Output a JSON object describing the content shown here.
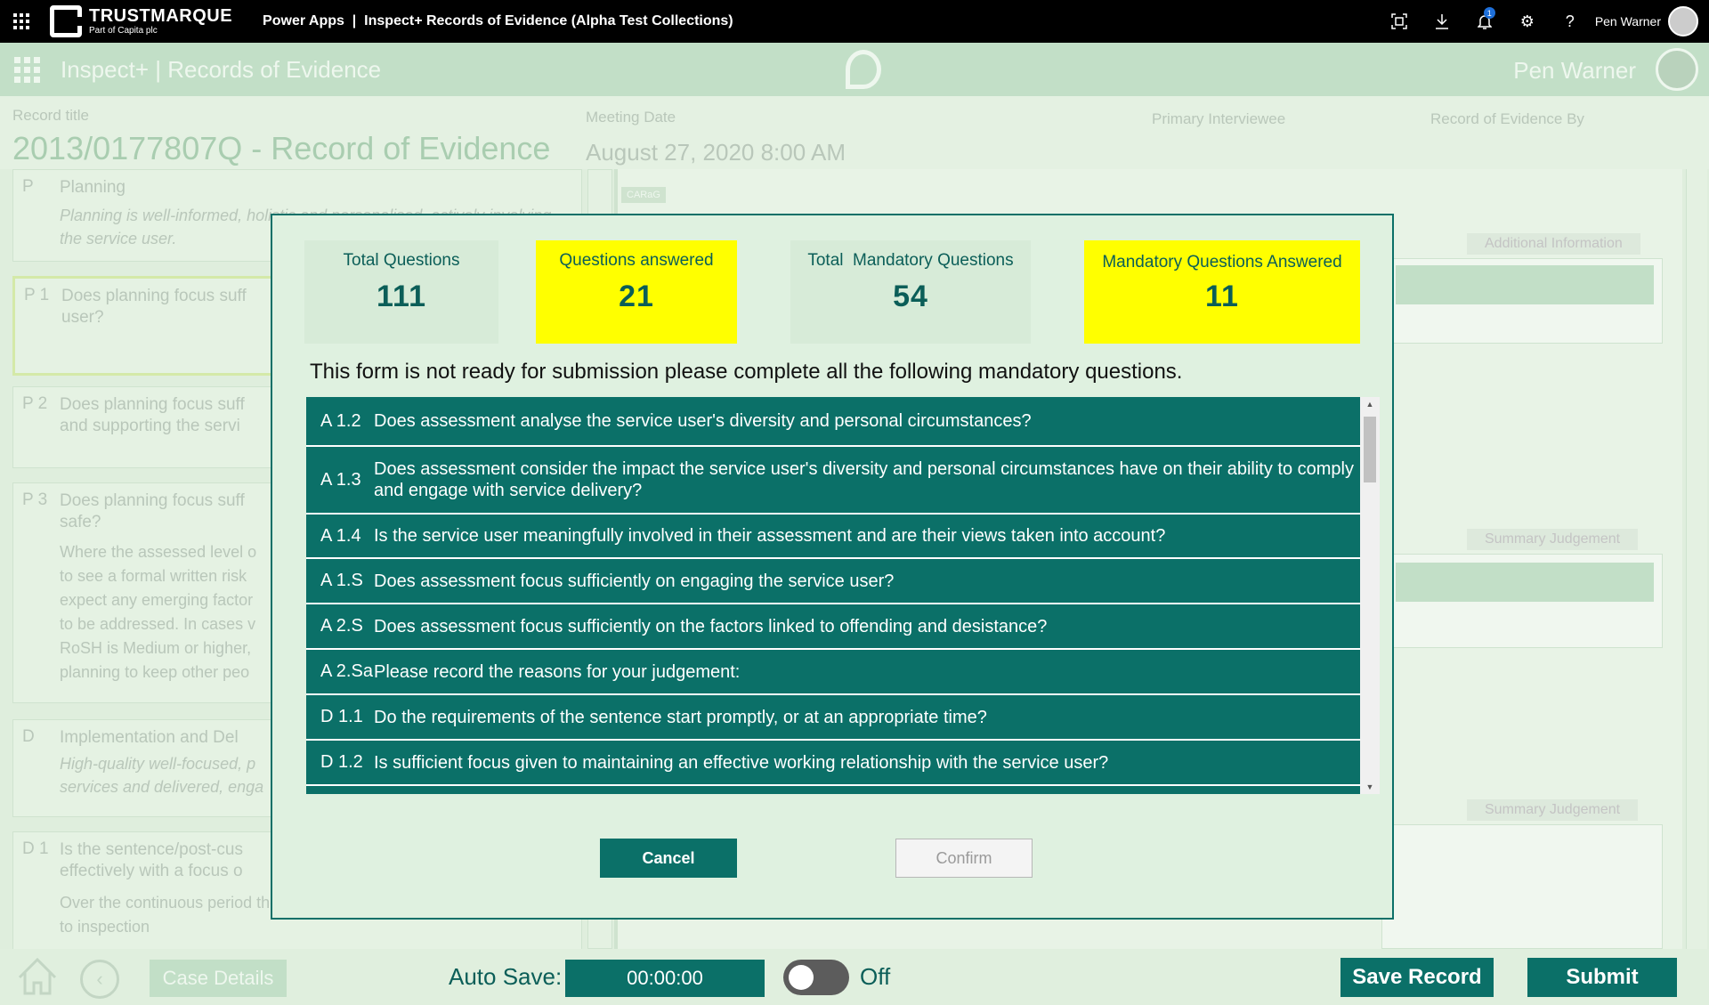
{
  "topbar": {
    "brand_name": "TRUSTMARQUE",
    "brand_sub": "Part of Capita plc",
    "app_title": "Power Apps  |  Inspect+ Records of Evidence (Alpha Test Collections)",
    "notification_count": "1",
    "user_name": "Pen Warner"
  },
  "app_header": {
    "title": "Inspect+ | Records of Evidence",
    "user_name": "Pen Warner"
  },
  "record": {
    "title_label": "Record title",
    "title_value": "2013/0177807Q - Record of Evidence",
    "meeting_label": "Meeting Date",
    "meeting_value": "August 27, 2020 8:00 AM",
    "interviewee_label": "Primary Interviewee",
    "evidence_by_label": "Record of Evidence By"
  },
  "background": {
    "cards": [
      {
        "code": "P",
        "title": "Planning",
        "desc": "Planning is well-informed, holistic and personalised, actively involving the service user."
      },
      {
        "code": "P 1",
        "title": "Does planning focus suff user?"
      },
      {
        "code": "P 2",
        "title": "Does planning focus suff and supporting the servi"
      },
      {
        "code": "P 3",
        "title": "Does planning focus suff safe?",
        "body": "Where the assessed level o to see a formal written risk expect any emerging factor to be addressed. In cases v RoSH is Medium or higher, planning to keep other peo"
      },
      {
        "code": "D",
        "title": "Implementation and Del",
        "desc": "High-quality well-focused, p services and delivered, enga"
      },
      {
        "code": "D 1",
        "title": "Is the sentence/post-cus effectively with a focus o",
        "body": "Over the continuous period the order/post-release supervision subject to inspection"
      }
    ],
    "carag_tag": "CARaG",
    "additional_info_label": "Additional Information",
    "summary_label_1": "Summary Judgement",
    "summary_label_2": "Summary Judgement"
  },
  "modal": {
    "stats": [
      {
        "label": "Total Questions",
        "value": "111",
        "highlight": false
      },
      {
        "label": "Questions answered",
        "value": "21",
        "highlight": true
      },
      {
        "label": "Total  Mandatory Questions",
        "value": "54",
        "highlight": false
      },
      {
        "label": "Mandatory Questions Answered",
        "value": "11",
        "highlight": true
      }
    ],
    "warning": "This form is not ready for submission please complete all the following mandatory questions.",
    "questions": [
      {
        "code": "A 1.2",
        "text": "Does assessment analyse the service user's diversity and personal circumstances?"
      },
      {
        "code": "A 1.3",
        "text": "Does assessment consider the impact the service user's diversity and personal circumstances have on their ability to comply and engage with service delivery?"
      },
      {
        "code": "A 1.4",
        "text": "Is the service user meaningfully involved in their assessment and are their views taken into account?"
      },
      {
        "code": "A 1.S",
        "text": "Does assessment focus sufficiently on engaging the service user?"
      },
      {
        "code": "A 2.S",
        "text": "Does assessment focus sufficiently on the factors linked to offending and desistance?"
      },
      {
        "code": "A 2.Sa",
        "text": "Please record the reasons for your judgement:"
      },
      {
        "code": "D 1.1",
        "text": "Do the requirements of the sentence start promptly, or at an appropriate time?"
      },
      {
        "code": "D 1.2",
        "text": "Is sufficient focus given to maintaining an effective working relationship with the service user?"
      }
    ],
    "cancel_label": "Cancel",
    "confirm_label": "Confirm"
  },
  "footer": {
    "case_details_label": "Case Details",
    "autosave_label": "Auto Save:",
    "autosave_time": "00:00:00",
    "toggle_state": "Off",
    "save_label": "Save Record",
    "submit_label": "Submit"
  },
  "colors": {
    "primary": "#0b7068",
    "highlight": "#ffff00",
    "dialog_bg": "#dff1e0"
  }
}
